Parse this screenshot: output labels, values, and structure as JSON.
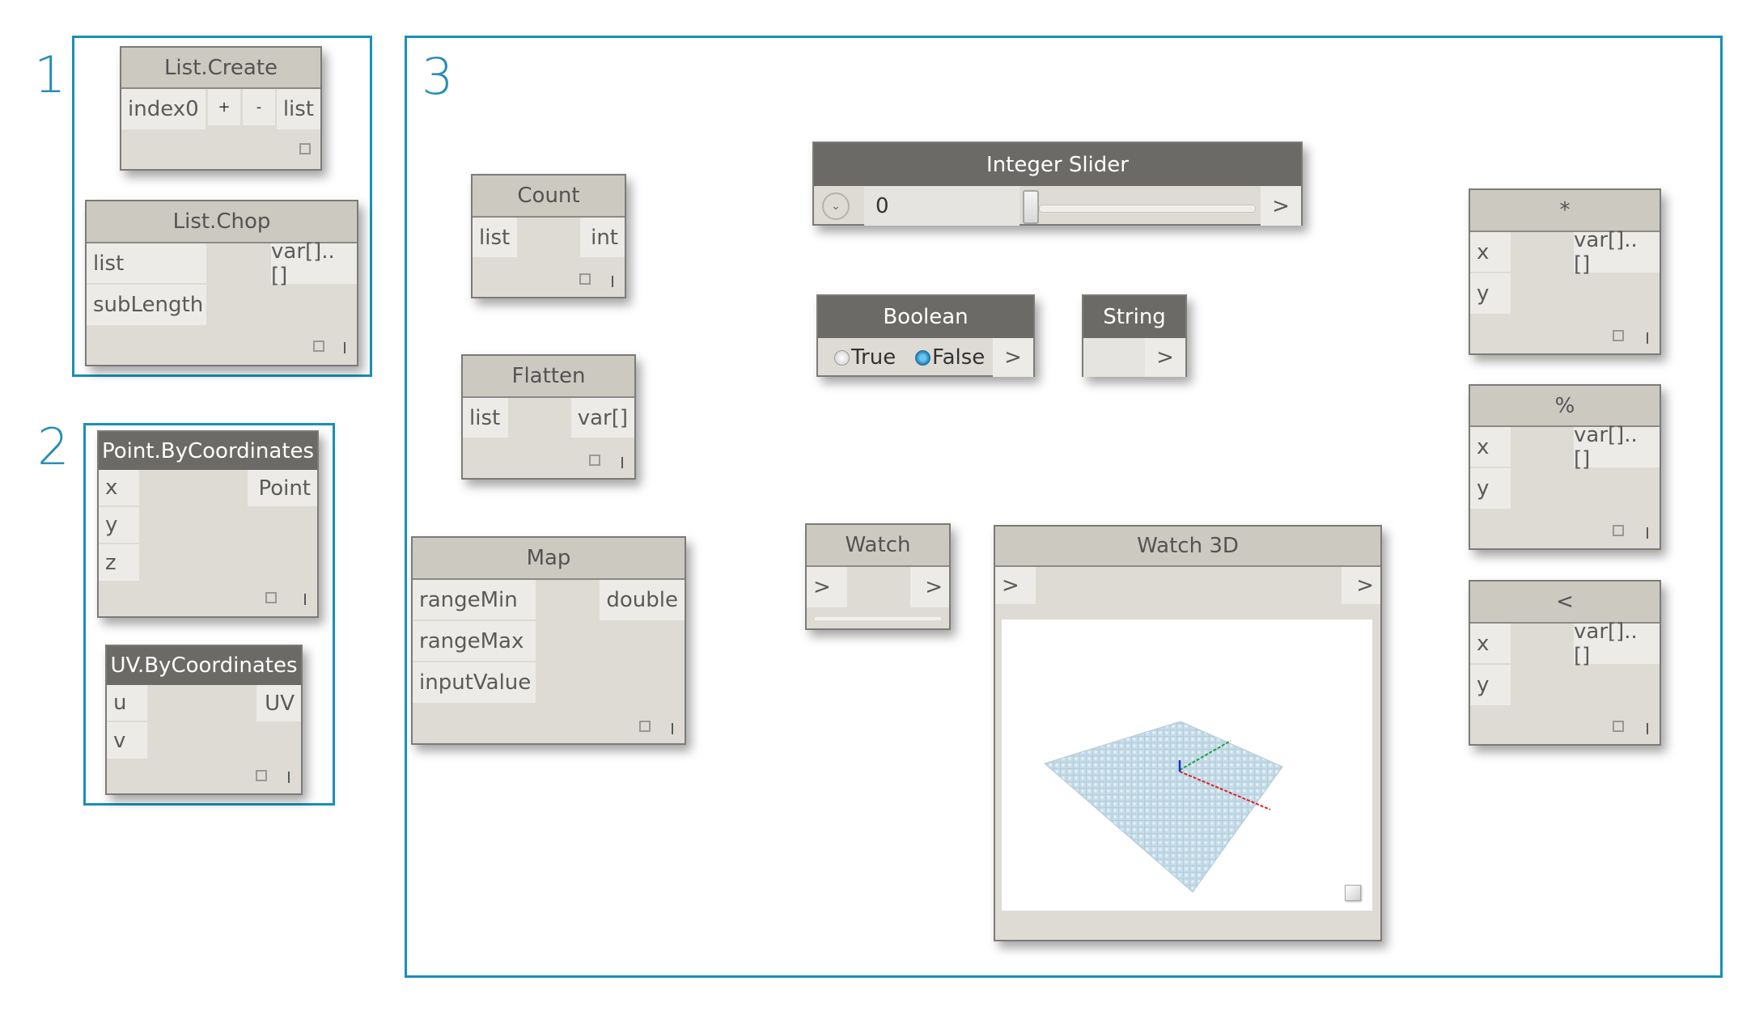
{
  "groups": [
    {
      "label": "1"
    },
    {
      "label": "2"
    },
    {
      "label": "3"
    }
  ],
  "nodes": {
    "list_create": {
      "title": "List.Create",
      "inputs": [
        "index0"
      ],
      "add_label": "+",
      "remove_label": "-",
      "outputs": [
        "list"
      ]
    },
    "list_chop": {
      "title": "List.Chop",
      "inputs": [
        "list",
        "subLength"
      ],
      "outputs": [
        "var[]..[]"
      ]
    },
    "point_by_coordinates": {
      "title": "Point.ByCoordinates",
      "inputs": [
        "x",
        "y",
        "z"
      ],
      "outputs": [
        "Point"
      ]
    },
    "uv_by_coordinates": {
      "title": "UV.ByCoordinates",
      "inputs": [
        "u",
        "v"
      ],
      "outputs": [
        "UV"
      ]
    },
    "count": {
      "title": "Count",
      "inputs": [
        "list"
      ],
      "outputs": [
        "int"
      ]
    },
    "flatten": {
      "title": "Flatten",
      "inputs": [
        "list"
      ],
      "outputs": [
        "var[]"
      ]
    },
    "map": {
      "title": "Map",
      "inputs": [
        "rangeMin",
        "rangeMax",
        "inputValue"
      ],
      "outputs": [
        "double"
      ]
    },
    "integer_slider": {
      "title": "Integer Slider",
      "value": "0",
      "slider_fraction": 0.0,
      "output_label": ">"
    },
    "boolean": {
      "title": "Boolean",
      "options": [
        "True",
        "False"
      ],
      "selected": "False",
      "output_label": ">"
    },
    "string": {
      "title": "String",
      "value": "",
      "output_label": ">"
    },
    "watch": {
      "title": "Watch",
      "input_label": ">",
      "output_label": ">"
    },
    "watch3d": {
      "title": "Watch 3D",
      "input_label": ">",
      "output_label": ">"
    },
    "multiply": {
      "title": "*",
      "inputs": [
        "x",
        "y"
      ],
      "outputs": [
        "var[]..[]"
      ]
    },
    "modulo": {
      "title": "%",
      "inputs": [
        "x",
        "y"
      ],
      "outputs": [
        "var[]..[]"
      ]
    },
    "less_than": {
      "title": "<",
      "inputs": [
        "x",
        "y"
      ],
      "outputs": [
        "var[]..[]"
      ]
    }
  },
  "colors": {
    "group_border": "#1a8fb8",
    "axis_x": "#e02020",
    "axis_y": "#20a040",
    "axis_z": "#1030d0",
    "mesh": "#b9d7e6"
  }
}
